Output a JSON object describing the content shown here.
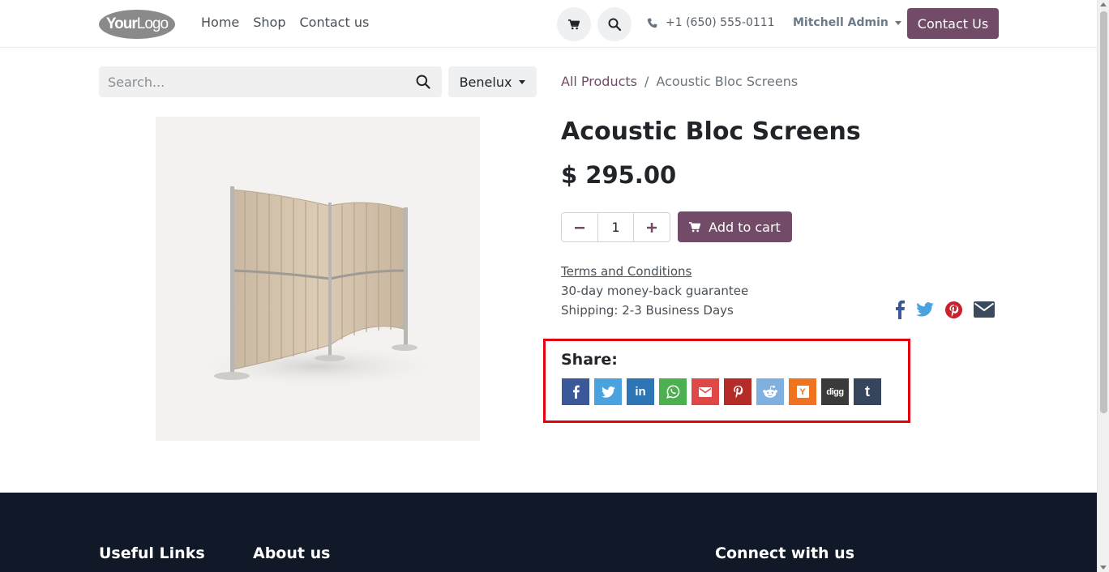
{
  "header": {
    "logo": {
      "bold": "Your",
      "light": "Logo"
    },
    "nav": [
      "Home",
      "Shop",
      "Contact us"
    ],
    "phone": "+1 (650) 555-0111",
    "user": "Mitchell Admin",
    "cta": "Contact Us"
  },
  "search": {
    "placeholder": "Search...",
    "pricelist": "Benelux"
  },
  "breadcrumb": {
    "parent": "All Products",
    "separator": "/",
    "current": "Acoustic Bloc Screens"
  },
  "product": {
    "title": "Acoustic Bloc Screens",
    "price": "$ 295.00",
    "quantity": "1",
    "add_to_cart": "Add to cart",
    "terms": "Terms and Conditions",
    "guarantee": "30-day money-back guarantee",
    "shipping": "Shipping: 2-3 Business Days"
  },
  "social_top": [
    "facebook-icon",
    "twitter-icon",
    "pinterest-icon",
    "email-icon"
  ],
  "share": {
    "label": "Share:",
    "buttons": [
      {
        "name": "facebook",
        "color": "#3b5998"
      },
      {
        "name": "twitter",
        "color": "#4aa3df"
      },
      {
        "name": "linkedin",
        "color": "#2e75b6"
      },
      {
        "name": "whatsapp",
        "color": "#4caf50"
      },
      {
        "name": "email",
        "color": "#e04848"
      },
      {
        "name": "pinterest",
        "color": "#b52b27"
      },
      {
        "name": "reddit",
        "color": "#7fb0e0"
      },
      {
        "name": "hacker-news",
        "color": "#f07420"
      },
      {
        "name": "digg",
        "color": "#3a3a3a"
      },
      {
        "name": "tumblr",
        "color": "#35465c"
      }
    ],
    "digg_text": "digg",
    "hn_text": "Y",
    "tumblr_text": "t",
    "linkedin_text": "in"
  },
  "footer": {
    "col1": "Useful Links",
    "col2": "About us",
    "col3": "Connect with us"
  },
  "colors": {
    "primary": "#714b67",
    "footer_bg": "#111827",
    "highlight": "#e3000f"
  }
}
